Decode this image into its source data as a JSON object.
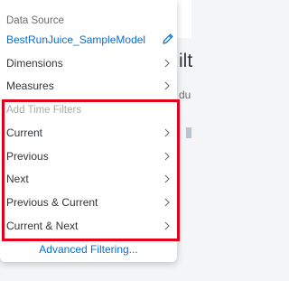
{
  "background": {
    "title_fragment": "ilt",
    "subtitle_fragment": "du"
  },
  "popover": {
    "data_source_label": "Data Source",
    "model_name": "BestRunJuice_SampleModel",
    "menu": [
      {
        "label": "Dimensions"
      },
      {
        "label": "Measures"
      }
    ],
    "time_filters_header": "Add Time Filters",
    "time_filters": [
      {
        "label": "Current"
      },
      {
        "label": "Previous"
      },
      {
        "label": "Next"
      },
      {
        "label": "Previous & Current"
      },
      {
        "label": "Current & Next"
      }
    ],
    "advanced_link": "Advanced Filtering..."
  },
  "icons": {
    "edit": "pencil-icon",
    "submenu": "chevron-right-icon"
  },
  "colors": {
    "link": "#0a6ed1",
    "highlight_border": "#e2001a",
    "muted_text": "#6a6d70",
    "disabled_text": "#a9a9a9"
  }
}
